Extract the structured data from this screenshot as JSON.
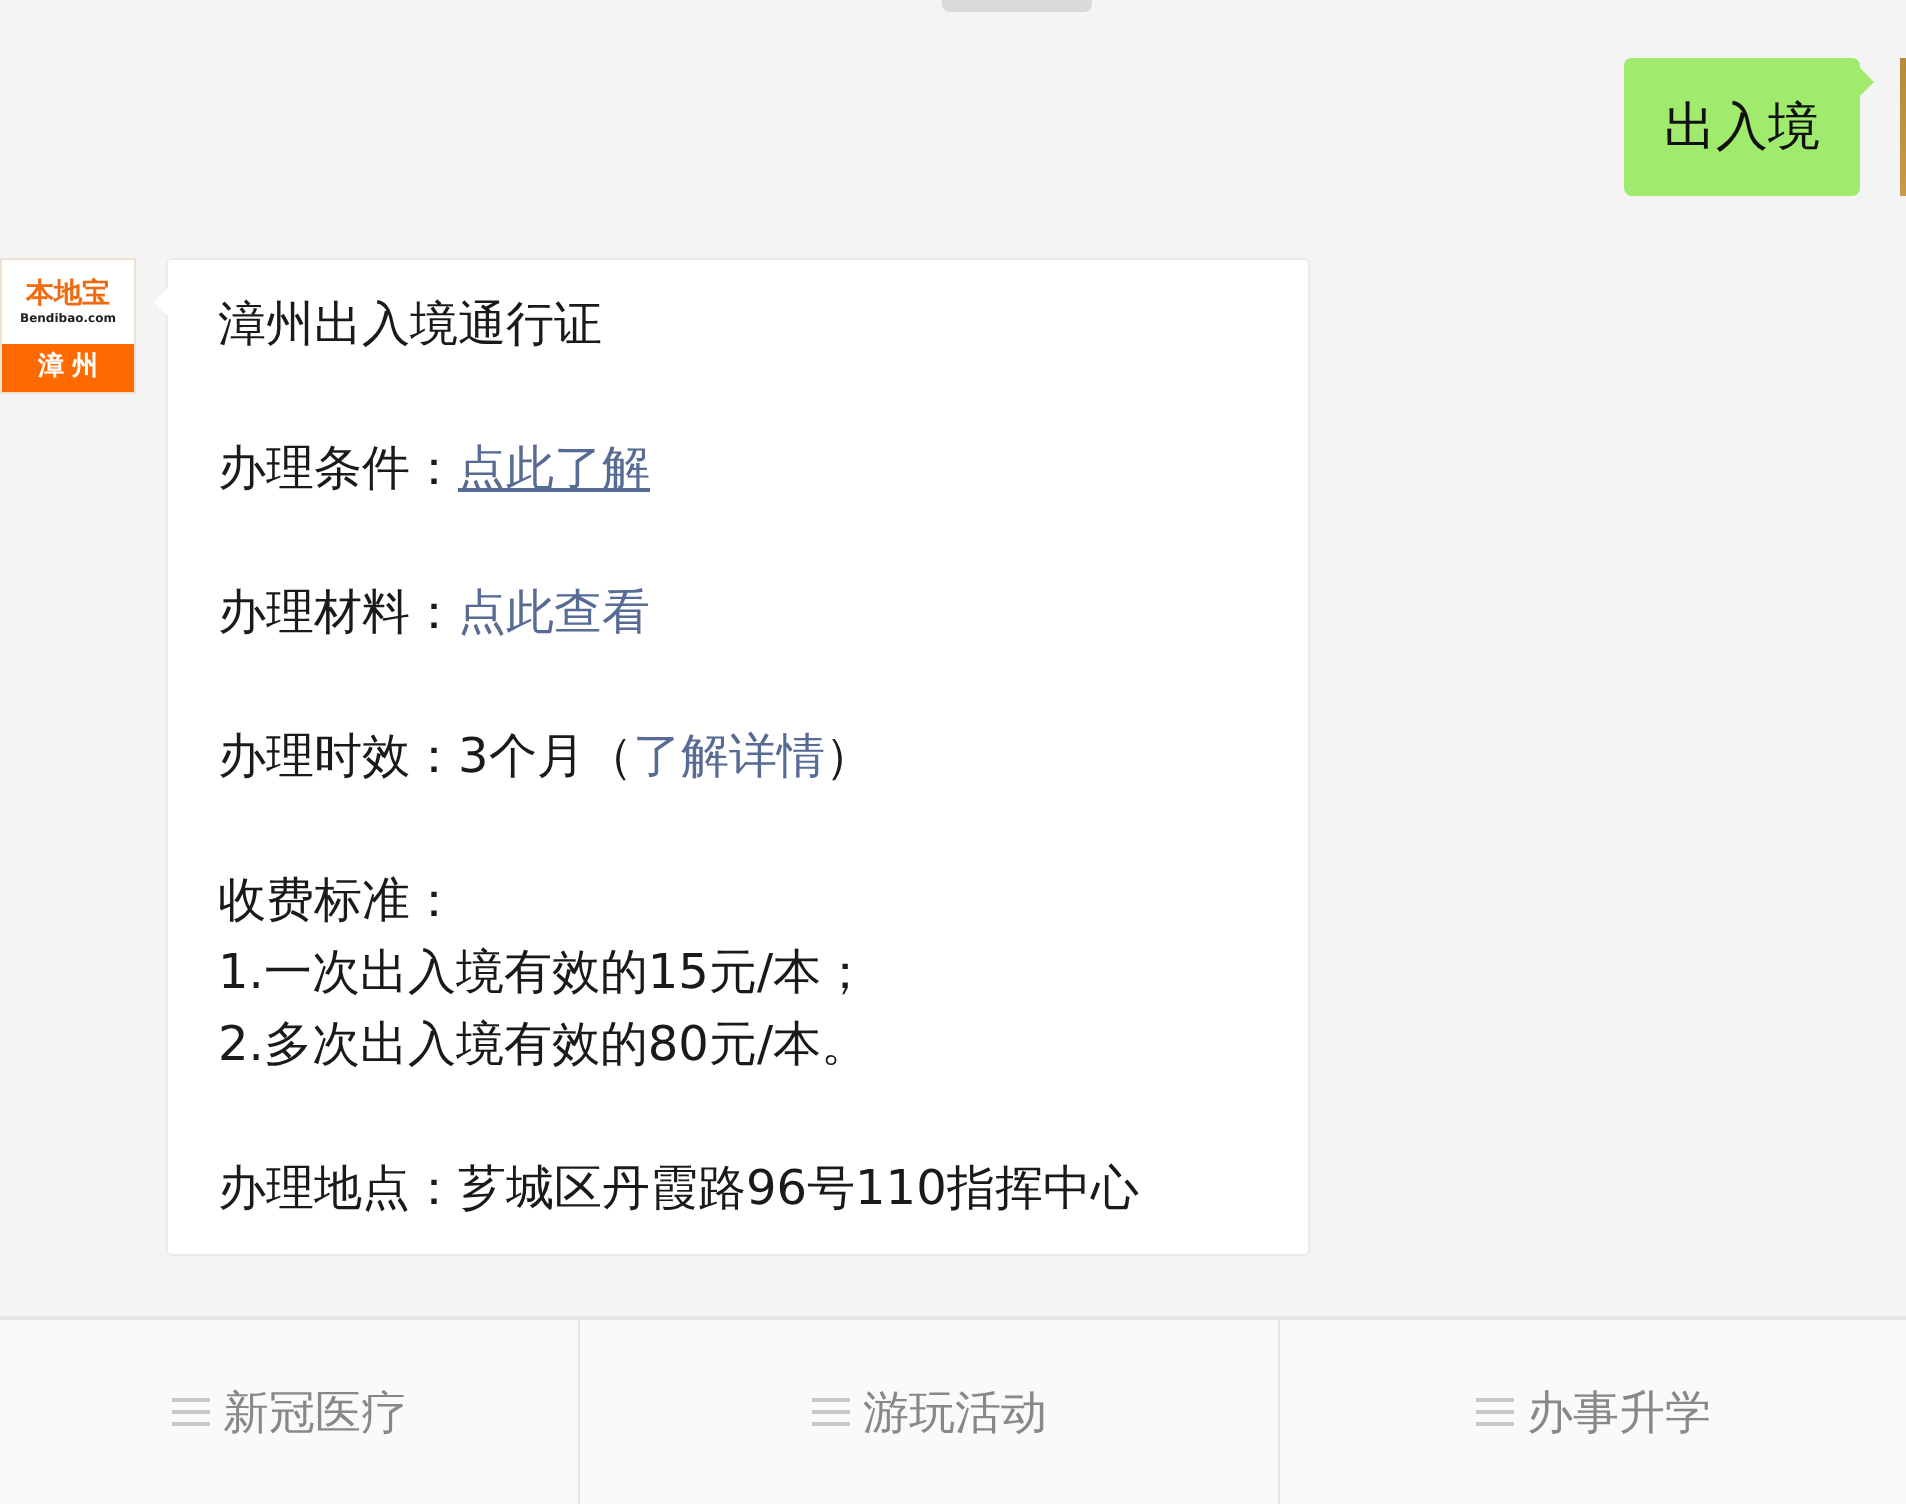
{
  "user_message": {
    "text": "出入境"
  },
  "bot_avatar": {
    "brand": "本地宝",
    "site": "Bendibao.com",
    "city": "漳州"
  },
  "bot_message": {
    "blocks": [
      [
        [
          {
            "kind": "text",
            "text": "漳州出入境通行证"
          }
        ]
      ],
      [
        [
          {
            "kind": "text",
            "text": "办理条件："
          },
          {
            "kind": "link",
            "text": "点此了解",
            "underlined": true
          }
        ]
      ],
      [
        [
          {
            "kind": "text",
            "text": "办理材料："
          },
          {
            "kind": "link",
            "text": "点此查看",
            "underlined": false
          }
        ]
      ],
      [
        [
          {
            "kind": "text",
            "text": "办理时效：3个月（"
          },
          {
            "kind": "link",
            "text": "了解详情",
            "underlined": false
          },
          {
            "kind": "text",
            "text": "）"
          }
        ]
      ],
      [
        [
          {
            "kind": "text",
            "text": "收费标准："
          }
        ],
        [
          {
            "kind": "text",
            "text": "1.一次出入境有效的15元/本；"
          }
        ],
        [
          {
            "kind": "text",
            "text": "2.多次出入境有效的80元/本。"
          }
        ]
      ],
      [
        [
          {
            "kind": "text",
            "text": "办理地点：芗城区丹霞路96号110指挥中心"
          }
        ]
      ]
    ]
  },
  "bottom_menu": [
    {
      "label": "新冠医疗"
    },
    {
      "label": "游玩活动"
    },
    {
      "label": "办事升学"
    }
  ]
}
